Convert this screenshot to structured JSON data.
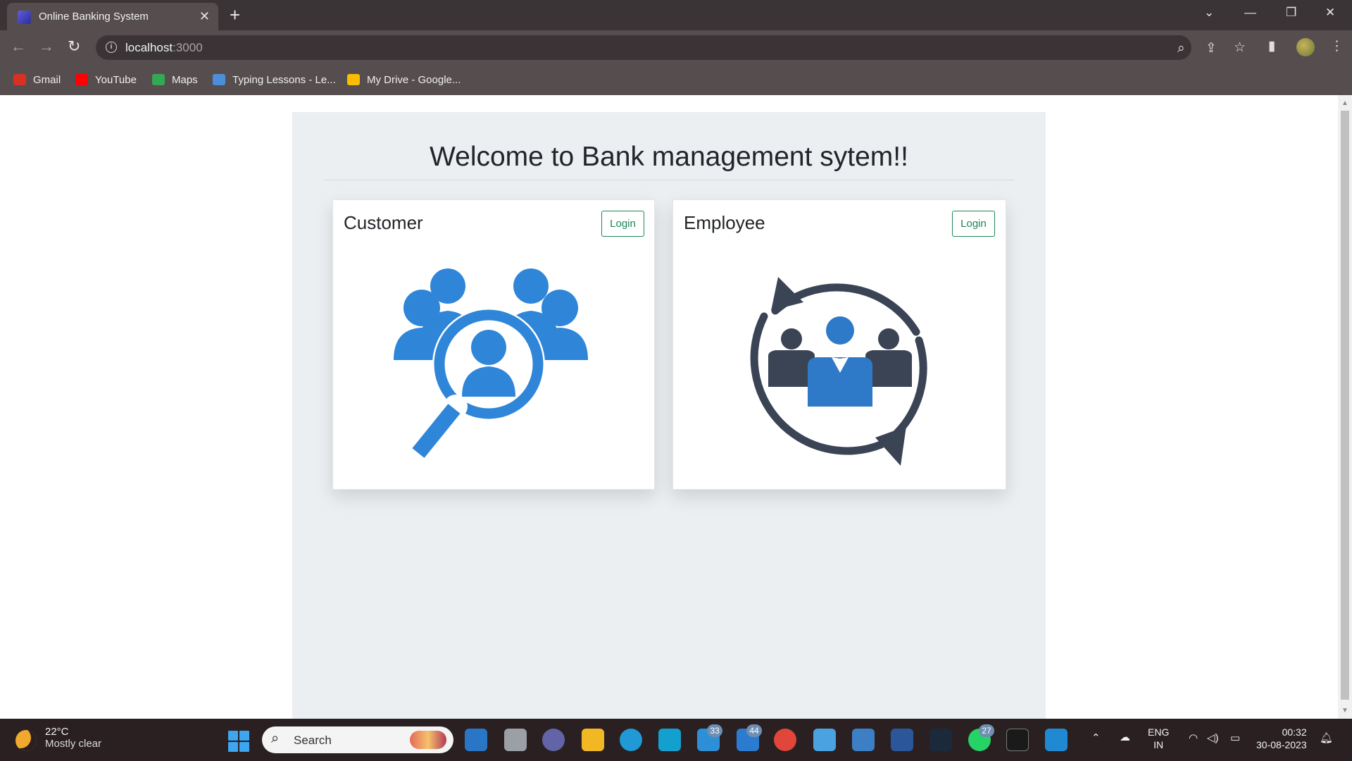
{
  "browser": {
    "tab_title": "Online Banking System",
    "tab_close": "✕",
    "new_tab": "+",
    "url_host": "localhost",
    "url_port": ":3000",
    "bookmarks": [
      {
        "label": "Gmail",
        "icon": "gmail-icon",
        "color": "#d93025"
      },
      {
        "label": "YouTube",
        "icon": "youtube-icon",
        "color": "#ff0000"
      },
      {
        "label": "Maps",
        "icon": "maps-icon",
        "color": "#34a853"
      },
      {
        "label": "Typing Lessons - Le...",
        "icon": "typing-icon",
        "color": "#4a8fd8"
      },
      {
        "label": "My Drive - Google...",
        "icon": "drive-icon",
        "color": "#fbbc04"
      }
    ]
  },
  "page": {
    "heading": "Welcome to Bank management sytem!!",
    "cards": [
      {
        "title": "Customer",
        "button": "Login",
        "illustration": "customer-search-icon",
        "color": "#2f86d8"
      },
      {
        "title": "Employee",
        "button": "Login",
        "illustration": "employee-team-icon",
        "color": "#3a4455"
      }
    ],
    "button_color": "#198754"
  },
  "taskbar": {
    "temperature": "22°C",
    "weather": "Mostly clear",
    "search_placeholder": "Search",
    "badges": [
      "33",
      "44",
      "27"
    ],
    "lang_1": "ENG",
    "lang_2": "IN",
    "time": "00:32",
    "date": "30-08-2023"
  }
}
